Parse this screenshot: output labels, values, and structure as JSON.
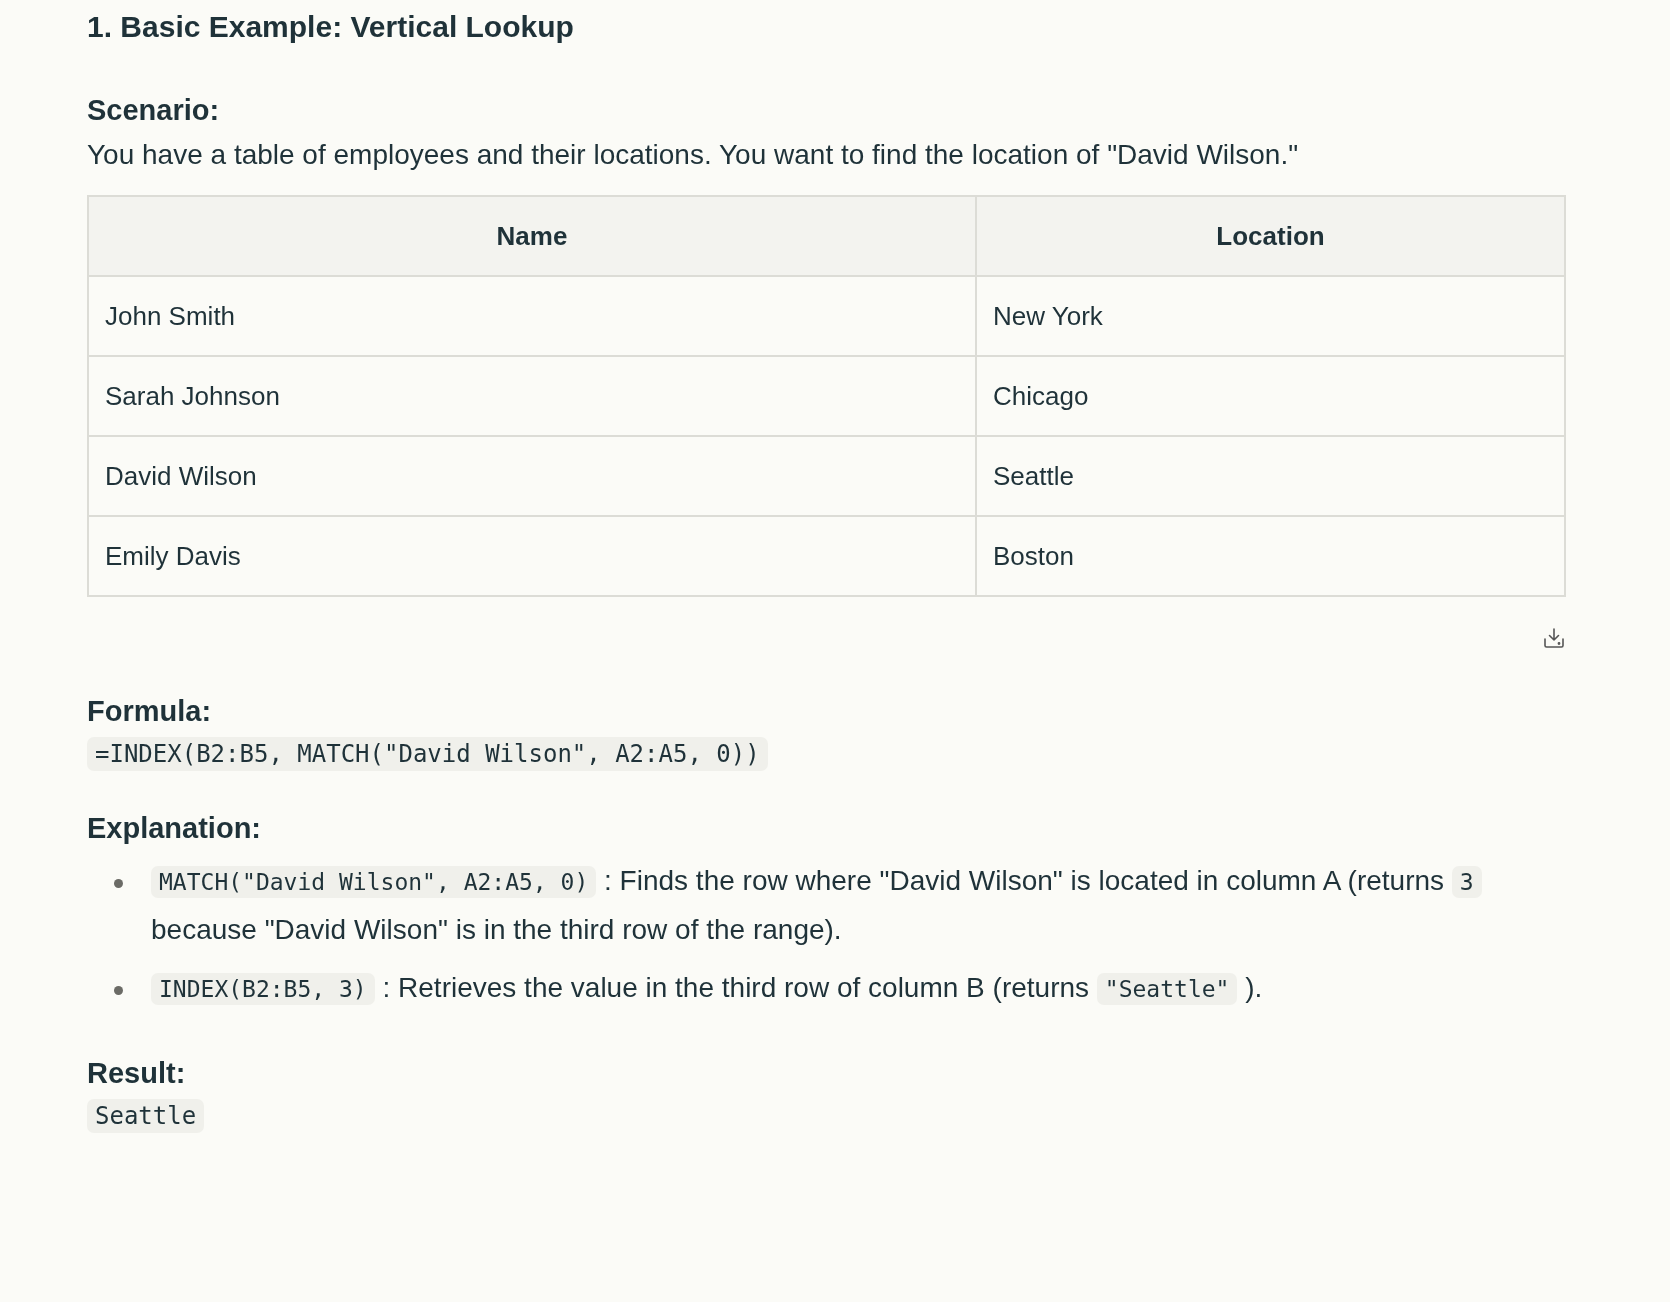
{
  "heading": "1. Basic Example: Vertical Lookup",
  "scenario": {
    "label": "Scenario:",
    "text": "You have a table of employees and their locations. You want to find the location of \"David Wilson.\""
  },
  "table": {
    "columns": [
      "Name",
      "Location"
    ],
    "rows": [
      [
        "John Smith",
        "New York"
      ],
      [
        "Sarah Johnson",
        "Chicago"
      ],
      [
        "David Wilson",
        "Seattle"
      ],
      [
        "Emily Davis",
        "Boston"
      ]
    ]
  },
  "formula": {
    "label": "Formula:",
    "code": "=INDEX(B2:B5, MATCH(\"David Wilson\", A2:A5, 0))"
  },
  "explanation": {
    "label": "Explanation:",
    "bullets": [
      [
        {
          "kind": "code",
          "text": "MATCH(\"David Wilson\", A2:A5, 0)"
        },
        {
          "kind": "text",
          "text": ": Finds the row where \"David Wilson\" is located in column A (returns"
        },
        {
          "kind": "code",
          "text": "3"
        },
        {
          "kind": "text",
          "text": "because \"David Wilson\" is in the third row of the range)."
        }
      ],
      [
        {
          "kind": "code",
          "text": "INDEX(B2:B5, 3)"
        },
        {
          "kind": "text",
          "text": ": Retrieves the value in the third row of column B (returns"
        },
        {
          "kind": "code",
          "text": "\"Seattle\""
        },
        {
          "kind": "text",
          "text": ")."
        }
      ]
    ]
  },
  "result": {
    "label": "Result:",
    "code": "Seattle"
  }
}
